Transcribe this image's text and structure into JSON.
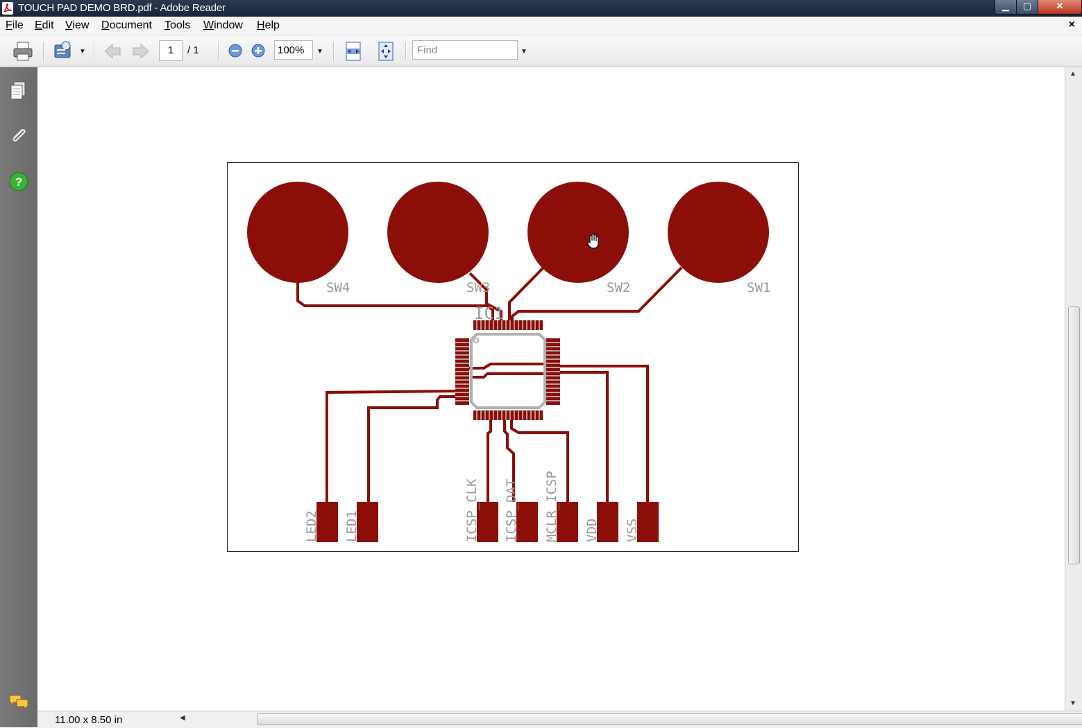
{
  "window": {
    "title": "TOUCH PAD DEMO BRD.pdf - Adobe Reader",
    "controls": {
      "minimize": "▁",
      "maximize": "▢",
      "close": "✕"
    }
  },
  "menu": {
    "items": [
      {
        "label": "File",
        "key": "F",
        "rest": "ile"
      },
      {
        "label": "Edit",
        "key": "E",
        "rest": "dit"
      },
      {
        "label": "View",
        "key": "V",
        "rest": "iew"
      },
      {
        "label": "Document",
        "key": "D",
        "rest": "ocument"
      },
      {
        "label": "Tools",
        "key": "T",
        "rest": "ools"
      },
      {
        "label": "Window",
        "key": "W",
        "rest": "indow"
      },
      {
        "label": "Help",
        "key": "H",
        "rest": "elp"
      }
    ],
    "close_doc": "×"
  },
  "toolbar": {
    "page_current": "1",
    "page_total": "/ 1",
    "zoom": "100%",
    "find_placeholder": "Find",
    "icons": [
      "print-icon",
      "collaborate-icon",
      "previous-page-icon",
      "next-page-icon",
      "zoom-out-icon",
      "zoom-in-icon",
      "fit-width-icon",
      "fit-page-icon"
    ]
  },
  "left_panel": {
    "icons": [
      "pages-icon",
      "attachments-icon",
      "help-icon",
      "comments-icon"
    ]
  },
  "status": {
    "page_size": "11.00 x 8.50 in"
  },
  "colors": {
    "copper": "#8b0e08",
    "silk": "#9a9a9a",
    "panel": "#707070"
  },
  "document": {
    "switches": [
      "SW4",
      "SW3",
      "SW2",
      "SW1"
    ],
    "chip_label": "IC1",
    "connectors": [
      "LED2",
      "LED1",
      "ICSP_CLK",
      "ICSP_DAT",
      "MCLR_ICSP",
      "VDD",
      "VSS"
    ]
  }
}
